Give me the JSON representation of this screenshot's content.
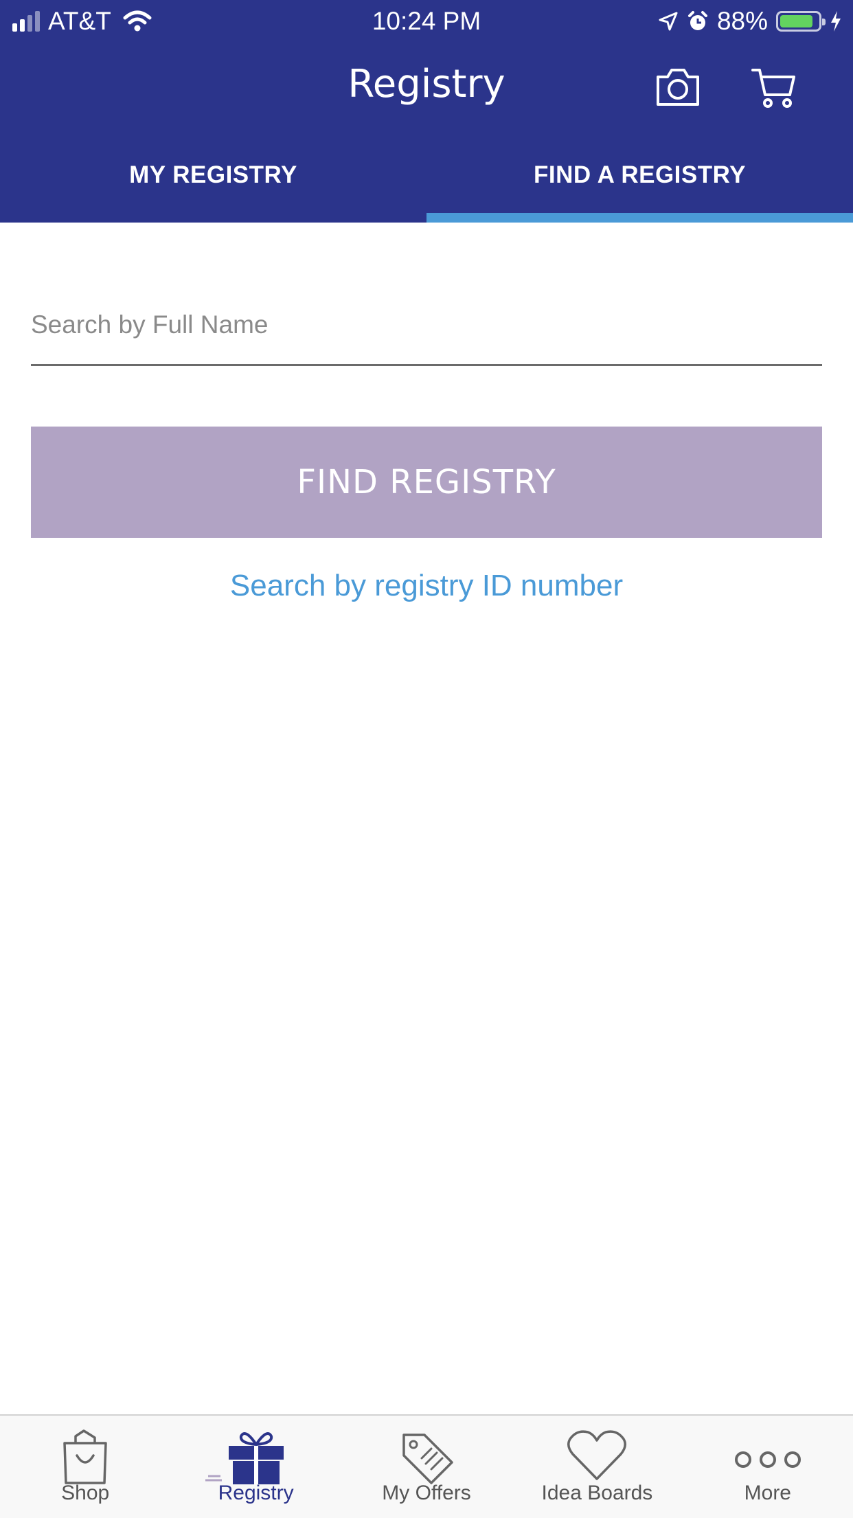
{
  "status_bar": {
    "carrier": "AT&T",
    "time": "10:24 PM",
    "battery_percent": "88%",
    "battery_level": 0.88,
    "icons": [
      "signal-icon",
      "wifi-icon",
      "location-icon",
      "alarm-icon",
      "battery-icon",
      "charging-icon"
    ]
  },
  "header": {
    "title": "Registry",
    "camera_icon": "camera-icon",
    "cart_icon": "cart-icon",
    "background_color": "#2b348b"
  },
  "tabs": [
    {
      "label": "MY REGISTRY",
      "selected": false
    },
    {
      "label": "FIND A REGISTRY",
      "selected": true
    }
  ],
  "tab_indicator_color": "#4a9ad7",
  "search": {
    "placeholder": "Search by Full Name",
    "value": ""
  },
  "find_button": {
    "label": "FIND REGISTRY",
    "color": "#b1a3c4"
  },
  "id_search_link": "Search by registry ID number",
  "bottom_nav": [
    {
      "label": "Shop",
      "icon": "shopping-bag-icon",
      "active": false
    },
    {
      "label": "Registry",
      "icon": "gift-icon",
      "active": true
    },
    {
      "label": "My Offers",
      "icon": "tag-icon",
      "active": false
    },
    {
      "label": "Idea Boards",
      "icon": "heart-icon",
      "active": false
    },
    {
      "label": "More",
      "icon": "more-dots-icon",
      "active": false
    }
  ]
}
